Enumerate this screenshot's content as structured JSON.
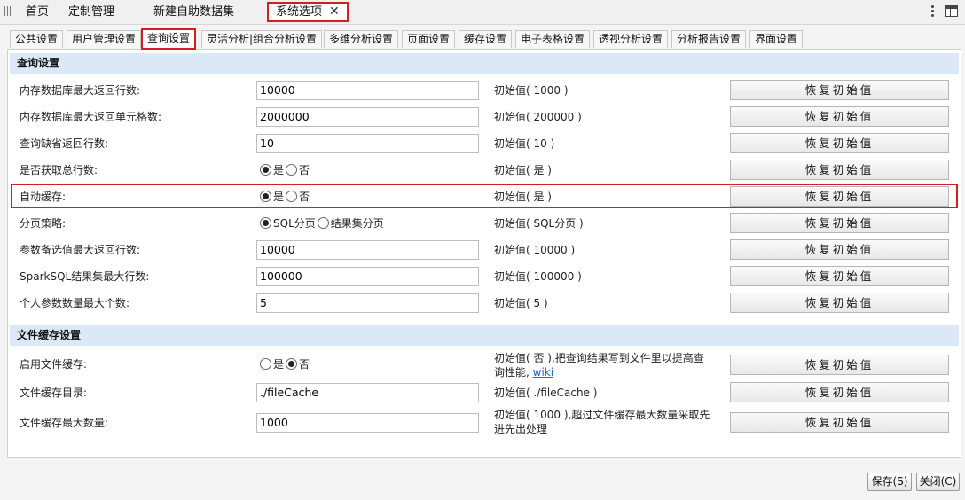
{
  "top_tabs": [
    "首页",
    "定制管理",
    "新建自助数据集",
    "系统选项"
  ],
  "close_glyph": "✕",
  "sub_tabs": [
    "公共设置",
    "用户管理设置",
    "查询设置",
    "灵活分析|组合分析设置",
    "多维分析设置",
    "页面设置",
    "缓存设置",
    "电子表格设置",
    "透视分析设置",
    "分析报告设置",
    "界面设置"
  ],
  "sections": {
    "query": "查询设置",
    "file_cache": "文件缓存设置"
  },
  "reset_label": "恢复初始值",
  "rows": [
    {
      "label": "内存数据库最大返回行数:",
      "value": "10000",
      "init": "初始值( 1000 )"
    },
    {
      "label": "内存数据库最大返回单元格数:",
      "value": "2000000",
      "init": "初始值( 200000 )"
    },
    {
      "label": "查询缺省返回行数:",
      "value": "10",
      "init": "初始值( 10 )"
    },
    {
      "label": "是否获取总行数:",
      "opt1": "是",
      "opt2": "否",
      "init": "初始值( 是 )"
    },
    {
      "label": "自动缓存:",
      "opt1": "是",
      "opt2": "否",
      "init": "初始值( 是 )"
    },
    {
      "label": "分页策略:",
      "opt1": "SQL分页",
      "opt2": "结果集分页",
      "init": "初始值( SQL分页 )"
    },
    {
      "label": "参数备选值最大返回行数:",
      "value": "10000",
      "init": "初始值( 10000 )"
    },
    {
      "label": "SparkSQL结果集最大行数:",
      "value": "100000",
      "init": "初始值( 100000 )"
    },
    {
      "label": "个人参数数量最大个数:",
      "value": "5",
      "init": "初始值( 5 )"
    }
  ],
  "file_rows": [
    {
      "label": "启用文件缓存:",
      "opt1": "是",
      "opt2": "否",
      "init": "初始值( 否 ),把查询结果写到文件里以提高查询性能,",
      "link": "wiki"
    },
    {
      "label": "文件缓存目录:",
      "value": "./fileCache",
      "init": "初始值( ./fileCache )"
    },
    {
      "label": "文件缓存最大数量:",
      "value": "1000",
      "init": "初始值( 1000 ),超过文件缓存最大数量采取先进先出处理"
    }
  ],
  "footer": {
    "save": "保存(S)",
    "close": "关闭(C)"
  }
}
